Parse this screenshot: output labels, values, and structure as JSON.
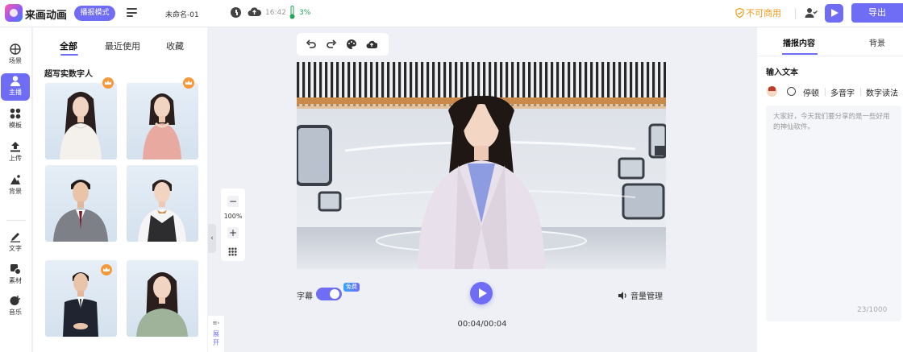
{
  "header": {
    "app_title": "来画动画",
    "mode_label": "播报模式",
    "doc_name": "未命名-01",
    "save_time": "16:42",
    "storage_percent": "3%",
    "license_text": "不可商用",
    "export_label": "导出"
  },
  "sidebar": {
    "items": [
      {
        "label": "场景",
        "icon": "scene-icon"
      },
      {
        "label": "主播",
        "icon": "anchor-icon"
      },
      {
        "label": "模板",
        "icon": "template-icon"
      },
      {
        "label": "上传",
        "icon": "upload-icon"
      },
      {
        "label": "背景",
        "icon": "background-icon"
      },
      {
        "label": "文字",
        "icon": "text-icon"
      },
      {
        "label": "素材",
        "icon": "material-icon"
      },
      {
        "label": "音乐",
        "icon": "music-icon"
      }
    ]
  },
  "avatar_panel": {
    "tabs": [
      "全部",
      "最近使用",
      "收藏"
    ],
    "section_title": "超写实数字人"
  },
  "canvas": {
    "zoom": "100%",
    "expand_label": "展开",
    "subtitle_label": "字幕",
    "free_badge": "免费",
    "volume_label": "音量管理",
    "timecode": "00:04/00:04"
  },
  "right_panel": {
    "tabs": [
      "播报内容",
      "背景"
    ],
    "input_title": "输入文本",
    "options": [
      "停顿",
      "多音字",
      "数字读法"
    ],
    "text_content": "大家好，今天我们要分享的是一些好用的神仙软件。",
    "char_count": "23/1000"
  },
  "colors": {
    "accent": "#6f6cf5",
    "license_warning": "#f09a18",
    "storage_ok": "#23a35a"
  }
}
